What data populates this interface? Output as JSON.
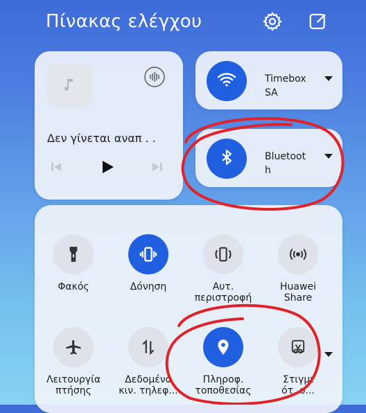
{
  "header": {
    "title": "Πίνακας ελέγχου",
    "icons": [
      "gear-icon",
      "edit-icon"
    ]
  },
  "media": {
    "title": "Δεν γίνεται αναπ . .",
    "icons": [
      "music-note-icon",
      "sound-effect-icon",
      "previous-icon",
      "play-icon",
      "next-icon"
    ]
  },
  "wifi": {
    "label": "Timebox\nSA",
    "active": true,
    "icon": "wifi-icon"
  },
  "bluetooth": {
    "label": "Bluetoot\nh",
    "active": true,
    "icon": "bluetooth-icon"
  },
  "toggles": [
    {
      "label": "Φακός",
      "icon": "flashlight-icon",
      "active": false
    },
    {
      "label": "Δόνηση",
      "icon": "vibration-icon",
      "active": true
    },
    {
      "label": "Αυτ.\nπεριστροφή",
      "icon": "auto-rotate-icon",
      "active": false
    },
    {
      "label": "Huawei\nShare",
      "icon": "huawei-share-icon",
      "active": false
    },
    {
      "label": "Λειτουργία\nπτήσης",
      "icon": "airplane-icon",
      "active": false
    },
    {
      "label": "Δεδομένα\nκιν. τηλεφ...",
      "icon": "mobile-data-icon",
      "active": false
    },
    {
      "label": "Πληροφ.\nτοποθεσίας",
      "icon": "location-icon",
      "active": true
    },
    {
      "label": "Στιγμι\nότ. ο...",
      "icon": "screenshot-icon",
      "active": false
    }
  ],
  "colors": {
    "accent": "#1f5fe0",
    "annotation": "#e0222a"
  }
}
